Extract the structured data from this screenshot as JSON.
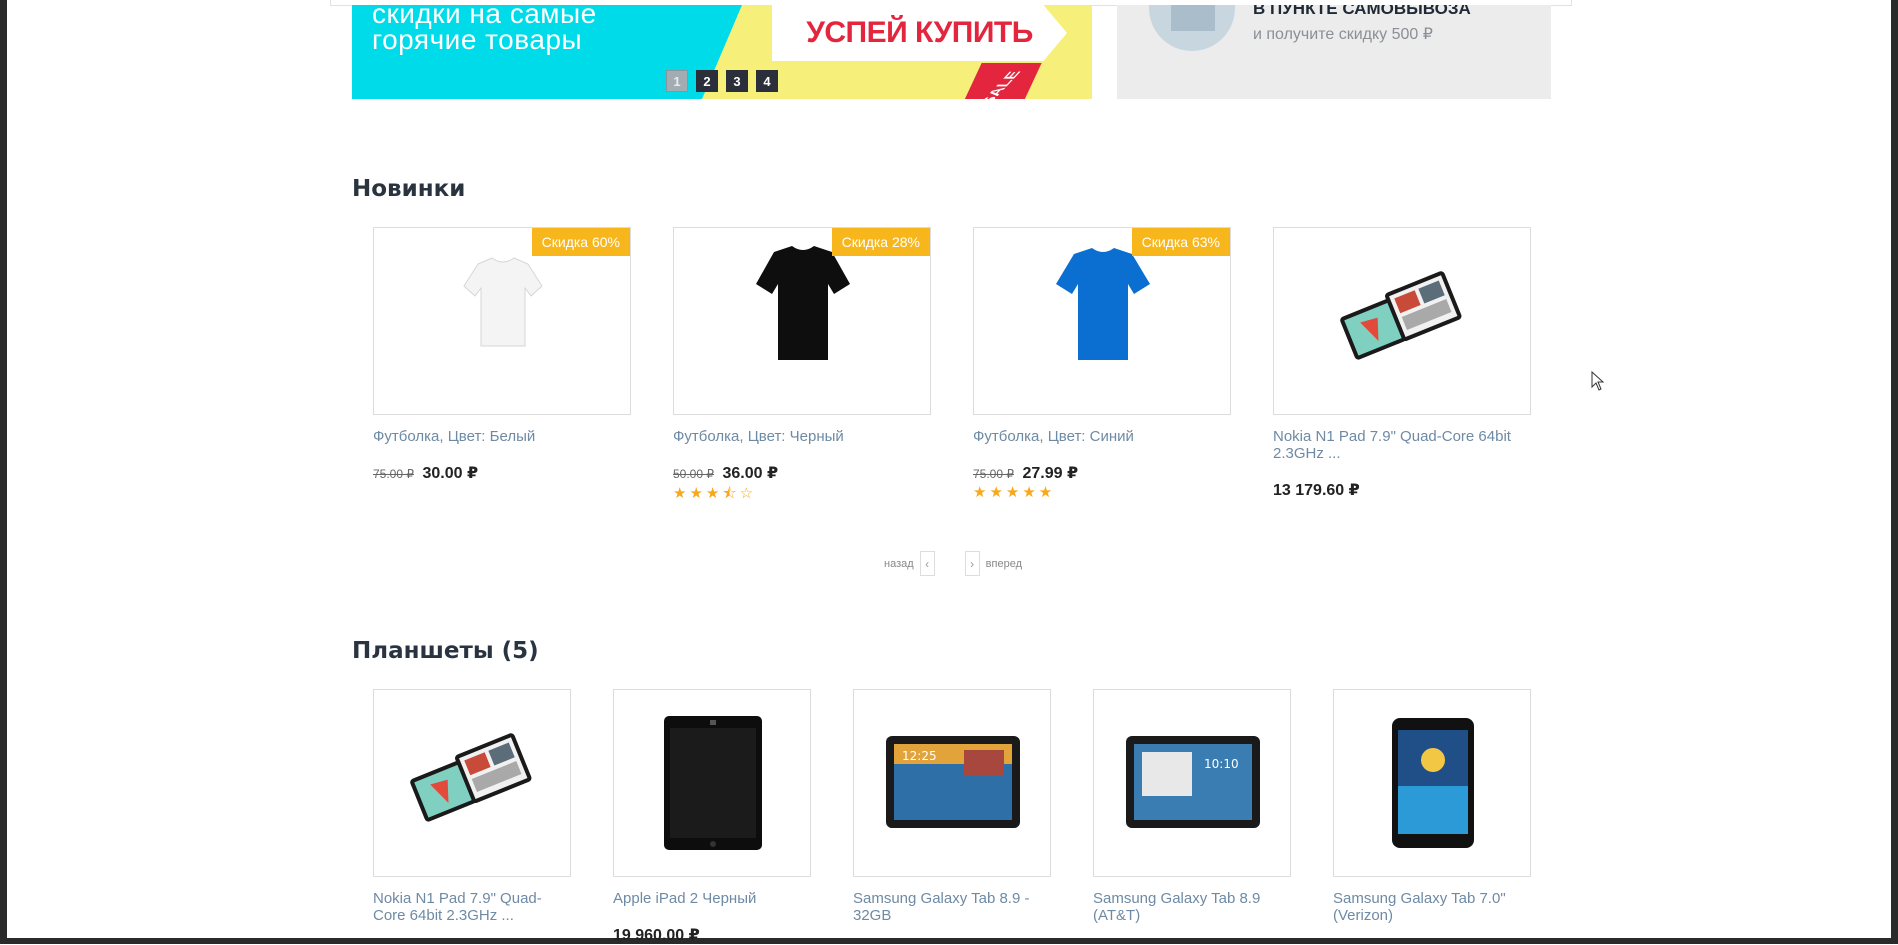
{
  "banner": {
    "text_line1": "скидки на самые",
    "text_line2": "горячие товары",
    "cta": "УСПЕЙ КУПИТЬ",
    "sale_label": "SALE",
    "slides": [
      "1",
      "2",
      "3",
      "4"
    ],
    "active_slide": "1",
    "bg_color": "#00dbe9",
    "accent_color": "#e3253d"
  },
  "promo": {
    "title": "В ПУНКТЕ САМОВЫВОЗА",
    "subtitle": "и получите скидку 500 ₽"
  },
  "new_products": {
    "title": "Новинки",
    "items": [
      {
        "name": "Футболка, Цвет: Белый",
        "badge": "Скидка 60%",
        "old_price": "75.00 ₽",
        "price": "30.00 ₽",
        "rating": 0
      },
      {
        "name": "Футболка, Цвет: Черный",
        "badge": "Скидка 28%",
        "old_price": "50.00 ₽",
        "price": "36.00 ₽",
        "rating": 3.5
      },
      {
        "name": "Футболка, Цвет: Синий",
        "badge": "Скидка 63%",
        "old_price": "75.00 ₽",
        "price": "27.99 ₽",
        "rating": 5
      },
      {
        "name": "Nokia N1 Pad 7.9\" Quad-Core 64bit 2.3GHz ...",
        "badge": "",
        "old_price": "",
        "price": "13 179.60 ₽",
        "rating": 0
      }
    ],
    "pager": {
      "prev": "назад",
      "next": "вперед"
    }
  },
  "tablets": {
    "title": "Планшеты (5)",
    "items": [
      {
        "name": "Nokia N1 Pad 7.9\" Quad-Core 64bit 2.3GHz ...",
        "price": ""
      },
      {
        "name": "Apple iPad 2 Черный",
        "price": "19 960.00 ₽"
      },
      {
        "name": "Samsung Galaxy Tab 8.9 - 32GB",
        "price": ""
      },
      {
        "name": "Samsung Galaxy Tab 8.9 (AT&T)",
        "price": ""
      },
      {
        "name": "Samsung Galaxy Tab 7.0\" (Verizon)",
        "price": ""
      }
    ]
  },
  "colors": {
    "badge": "#f7b71c",
    "link": "#6e8aa4",
    "star": "#f7a81b"
  }
}
